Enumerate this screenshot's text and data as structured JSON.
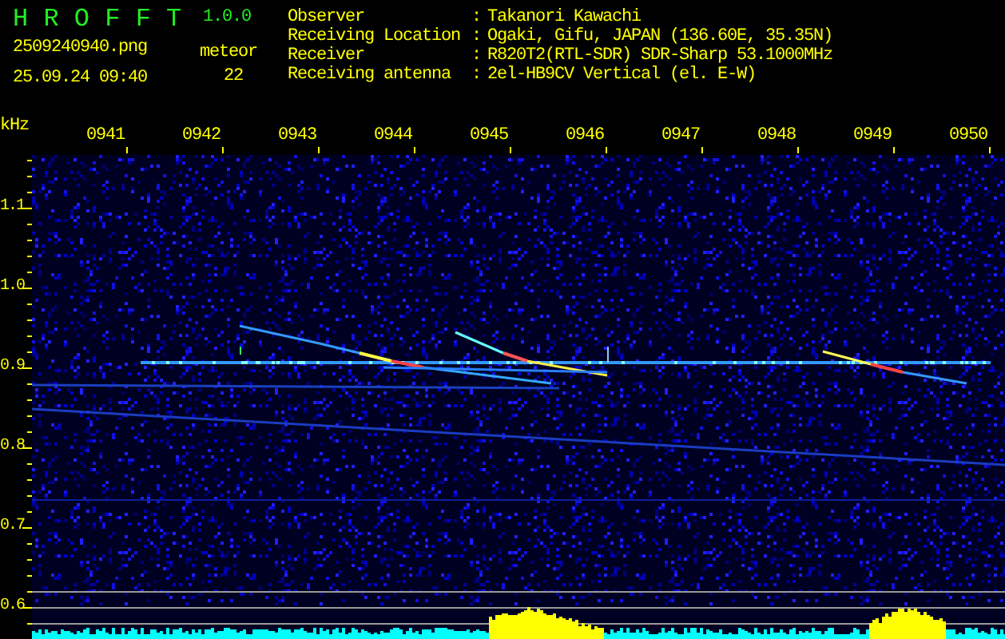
{
  "app": {
    "name": "H R O F F T",
    "version": "1.0.0"
  },
  "file": "2509240940.png",
  "datetime": "25.09.24 09:40",
  "meteor": {
    "label": "meteor",
    "count": "22"
  },
  "station_info": [
    {
      "label": "Observer",
      "separator": ":",
      "value": "Takanori Kawachi"
    },
    {
      "label": "Receiving Location",
      "separator": ":",
      "value": "Ogaki, Gifu, JAPAN (136.60E, 35.35N)"
    },
    {
      "label": "Receiver",
      "separator": ":",
      "value": "R820T2(RTL-SDR) SDR-Sharp 53.1000MHz"
    },
    {
      "label": "Receiving antenna",
      "separator": ":",
      "value": "2el-HB9CV Vertical (el. E-W)"
    }
  ],
  "spectrogram": {
    "unit": "kHz",
    "time_labels": [
      "0941",
      "0942",
      "0943",
      "0944",
      "0945",
      "0946",
      "0947",
      "0948",
      "0949",
      "0950"
    ],
    "frequency_labels": [
      "1.1",
      "1.0",
      "0.9",
      "0.8",
      "0.7",
      "0.6"
    ]
  }
}
